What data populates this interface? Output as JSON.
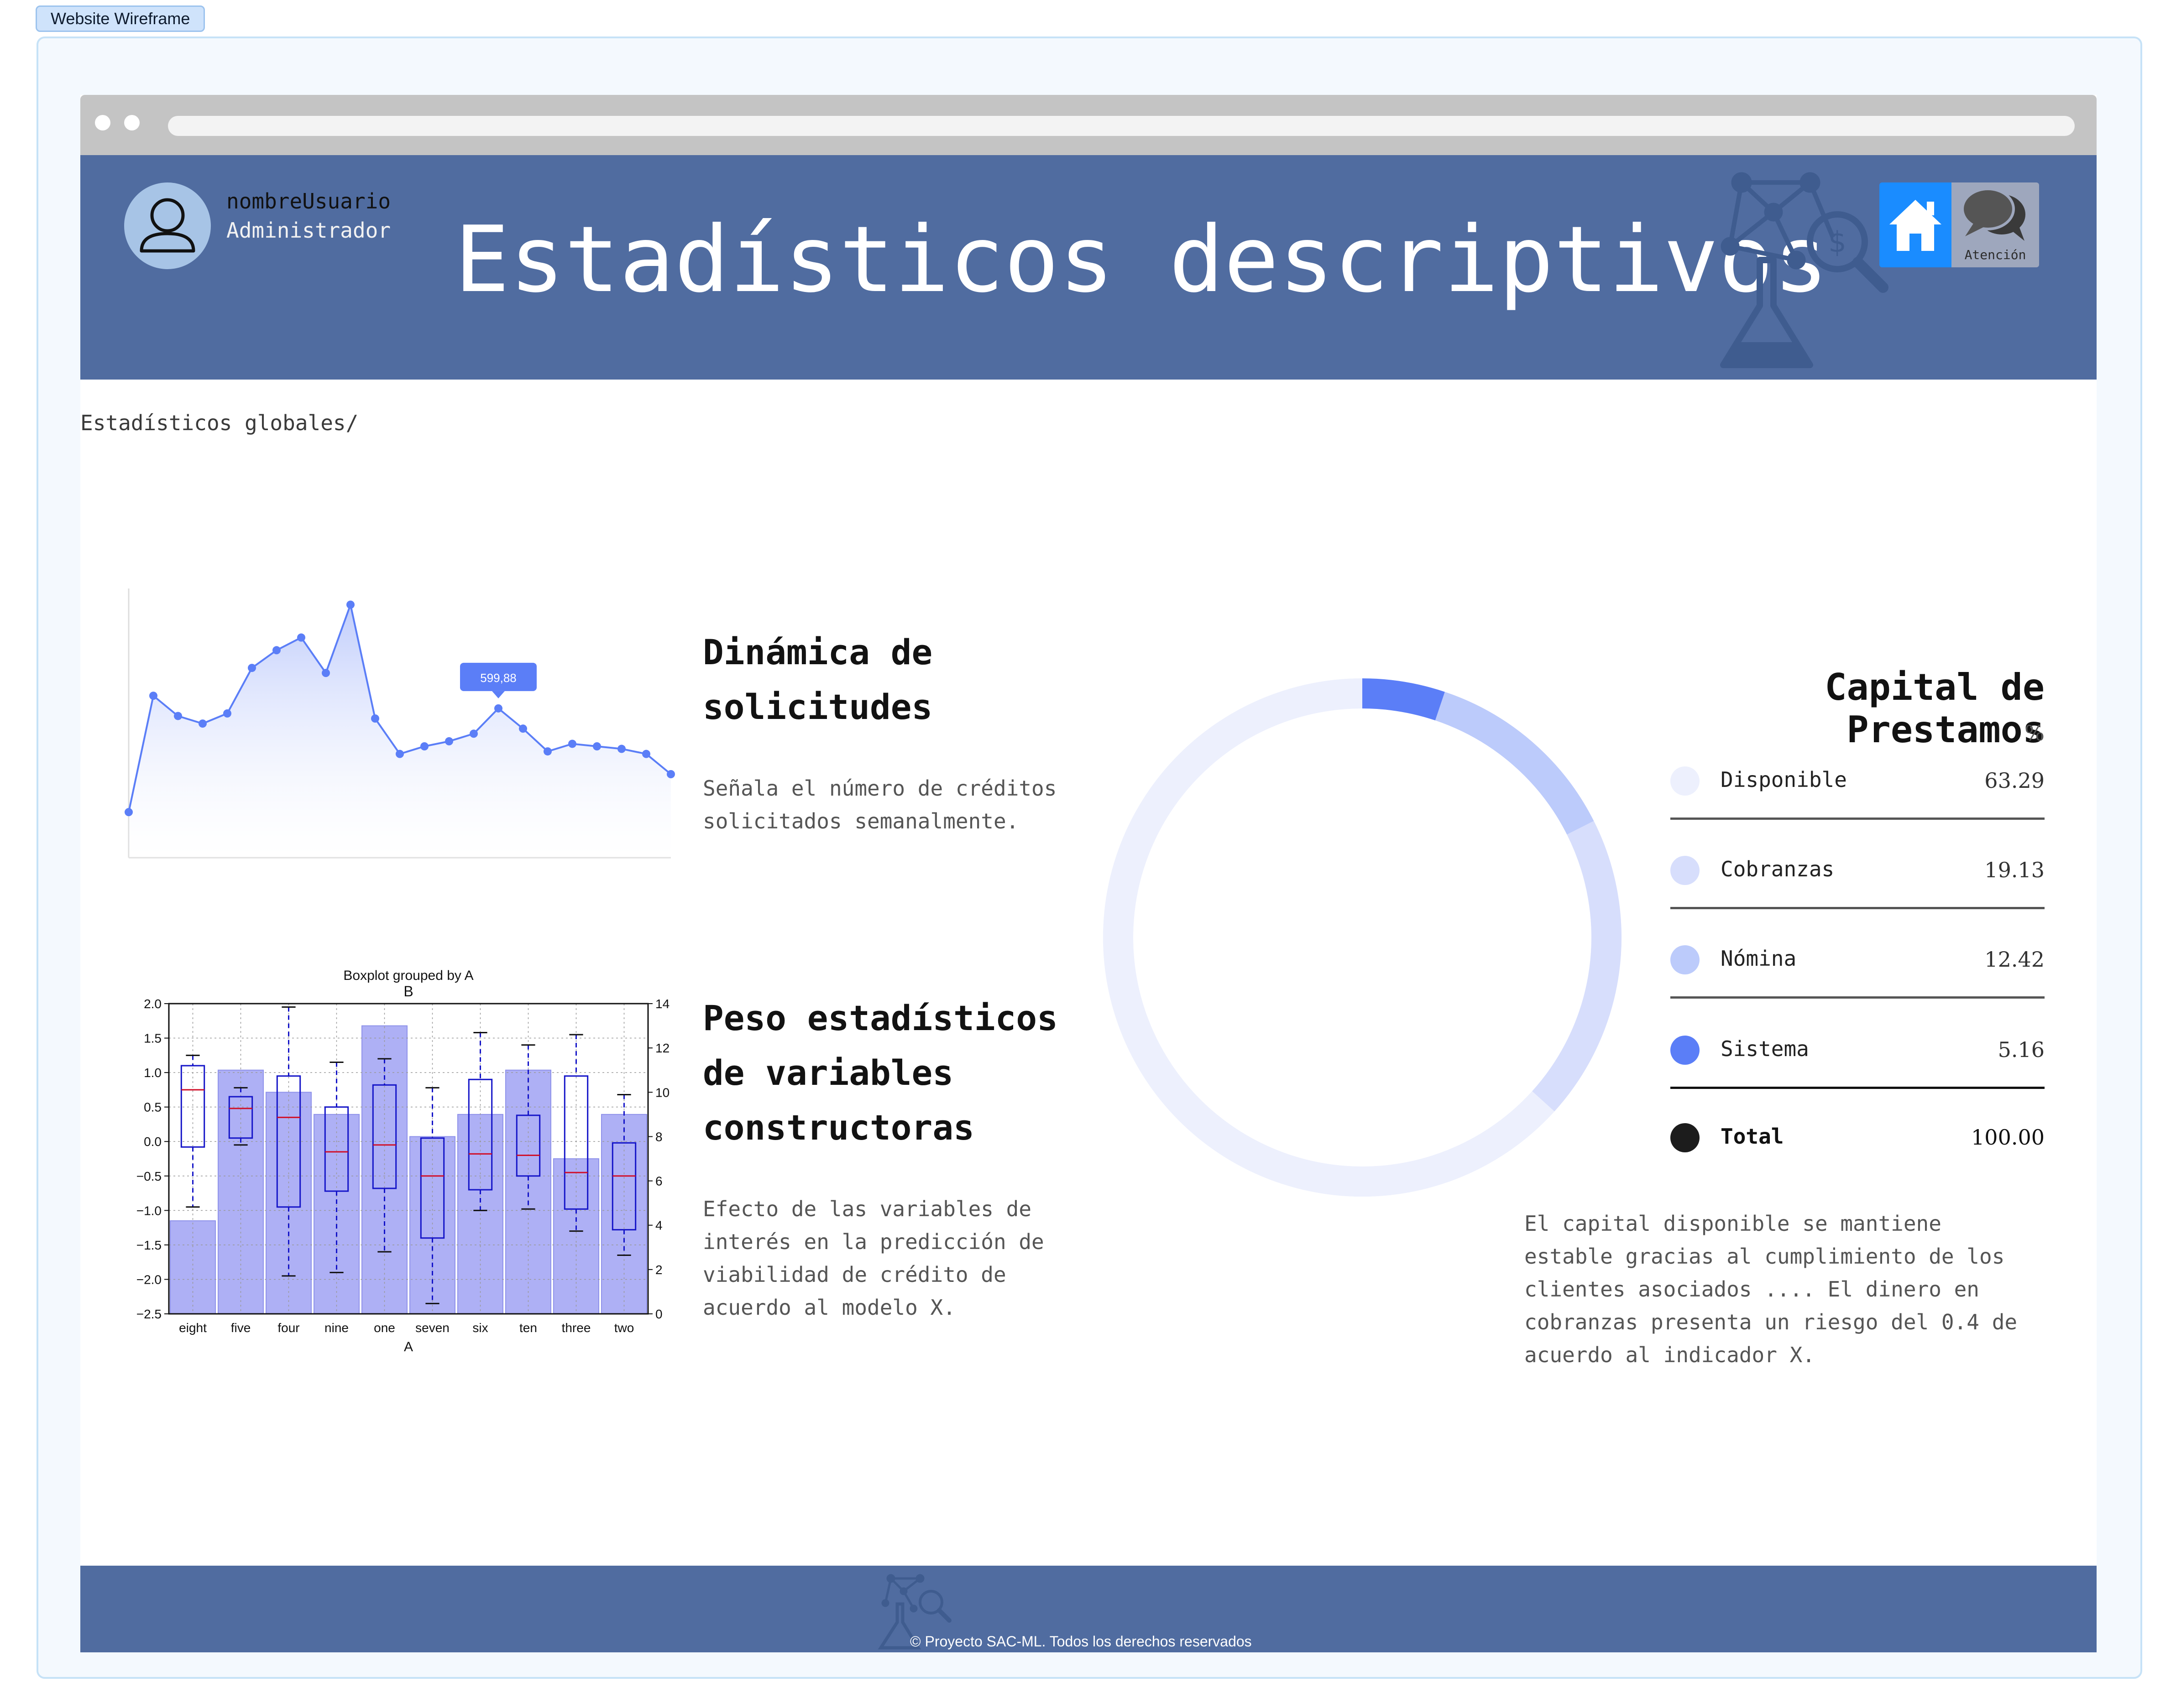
{
  "wireframe_tag": "Website Wireframe",
  "header": {
    "username": "nombreUsuario",
    "role": "Administrador",
    "title": "Estadísticos descriptivos",
    "home_icon": "home-icon",
    "chat_icon": "chat-bubbles-icon",
    "chat_label": "Atención"
  },
  "breadcrumb": "Estadísticos globales/",
  "section1": {
    "heading": "Dinámica de solicitudes",
    "heading_lines": [
      "Dinámica de",
      "solicitudes"
    ],
    "description_lines": [
      "Señala el número de créditos",
      "solicitados semanalmente."
    ]
  },
  "section2": {
    "heading_lines": [
      "Peso estadísticos",
      "de variables",
      "constructoras"
    ],
    "description_lines": [
      "Efecto de las variables de",
      "interés en la predicción de",
      "viabilidad de crédito de",
      "acuerdo al modelo X."
    ]
  },
  "capital": {
    "title": "Capital de Prestamos",
    "unit": "%",
    "items": [
      {
        "label": "Disponible",
        "value": "63.29",
        "color": "#edf0fd"
      },
      {
        "label": "Cobranzas",
        "value": "19.13",
        "color": "#d7defc"
      },
      {
        "label": "Nómina",
        "value": "12.42",
        "color": "#bccbfb"
      },
      {
        "label": "Sistema",
        "value": "5.16",
        "color": "#5b7ef7"
      }
    ],
    "total": {
      "label": "Total",
      "value": "100.00",
      "color": "#1c1c1c"
    },
    "description_lines": [
      "El capital disponible se mantiene",
      "estable gracias al cumplimiento de los",
      "clientes asociados .... El dinero en",
      "cobranzas presenta un riesgo del 0.4 de",
      "acuerdo al indicador X."
    ]
  },
  "footer": {
    "copyright": "© Proyecto SAC-ML. Todos los derechos reservados"
  },
  "chart_data": [
    {
      "type": "area",
      "tooltip": "599,88",
      "values": [
        0.18,
        0.64,
        0.56,
        0.53,
        0.57,
        0.75,
        0.82,
        0.87,
        0.73,
        1.0,
        0.55,
        0.41,
        0.44,
        0.46,
        0.49,
        0.59,
        0.51,
        0.42,
        0.45,
        0.44,
        0.43,
        0.41,
        0.33
      ],
      "tooltip_index": 15,
      "ylim": [
        0,
        1.1
      ],
      "color": "#5b7ef7"
    },
    {
      "type": "bar",
      "title": "Boxplot grouped by A",
      "subtitle": "B",
      "xlabel": "A",
      "categories": [
        "eight",
        "five",
        "four",
        "nine",
        "one",
        "seven",
        "six",
        "ten",
        "three",
        "two"
      ],
      "left_ticks": [
        "2.0",
        "1.5",
        "1.0",
        "0.5",
        "0.0",
        "−0.5",
        "−1.0",
        "−1.5",
        "−2.0",
        "−2.5"
      ],
      "right_ticks": [
        "14",
        "12",
        "10",
        "8",
        "6",
        "4",
        "2",
        "0"
      ],
      "bar_values": [
        4.2,
        11.0,
        10.0,
        9.0,
        13.0,
        8.0,
        9.0,
        11.0,
        7.0,
        9.0
      ],
      "bar_ylim": [
        0,
        14
      ],
      "box_ylim": [
        -2.5,
        2.0
      ],
      "boxes": [
        {
          "min": -0.95,
          "q1": -0.08,
          "median": 0.75,
          "q3": 1.1,
          "max": 1.25
        },
        {
          "min": -0.05,
          "q1": 0.05,
          "median": 0.48,
          "q3": 0.65,
          "max": 0.78
        },
        {
          "min": -1.95,
          "q1": -0.95,
          "median": 0.35,
          "q3": 0.95,
          "max": 1.95
        },
        {
          "min": -1.9,
          "q1": -0.72,
          "median": -0.15,
          "q3": 0.5,
          "max": 1.15
        },
        {
          "min": -1.6,
          "q1": -0.68,
          "median": -0.05,
          "q3": 0.82,
          "max": 1.2
        },
        {
          "min": -2.35,
          "q1": -1.4,
          "median": -0.5,
          "q3": 0.05,
          "max": 0.78
        },
        {
          "min": -1.0,
          "q1": -0.7,
          "median": -0.18,
          "q3": 0.9,
          "max": 1.58
        },
        {
          "min": -0.98,
          "q1": -0.5,
          "median": -0.2,
          "q3": 0.38,
          "max": 1.4
        },
        {
          "min": -1.3,
          "q1": -0.98,
          "median": -0.45,
          "q3": 0.95,
          "max": 1.55
        },
        {
          "min": -1.65,
          "q1": -1.28,
          "median": -0.5,
          "q3": -0.02,
          "max": 0.68
        }
      ]
    },
    {
      "type": "pie",
      "labels": [
        "Disponible",
        "Cobranzas",
        "Nómina",
        "Sistema"
      ],
      "values": [
        63.29,
        19.13,
        12.42,
        5.16
      ]
    }
  ]
}
